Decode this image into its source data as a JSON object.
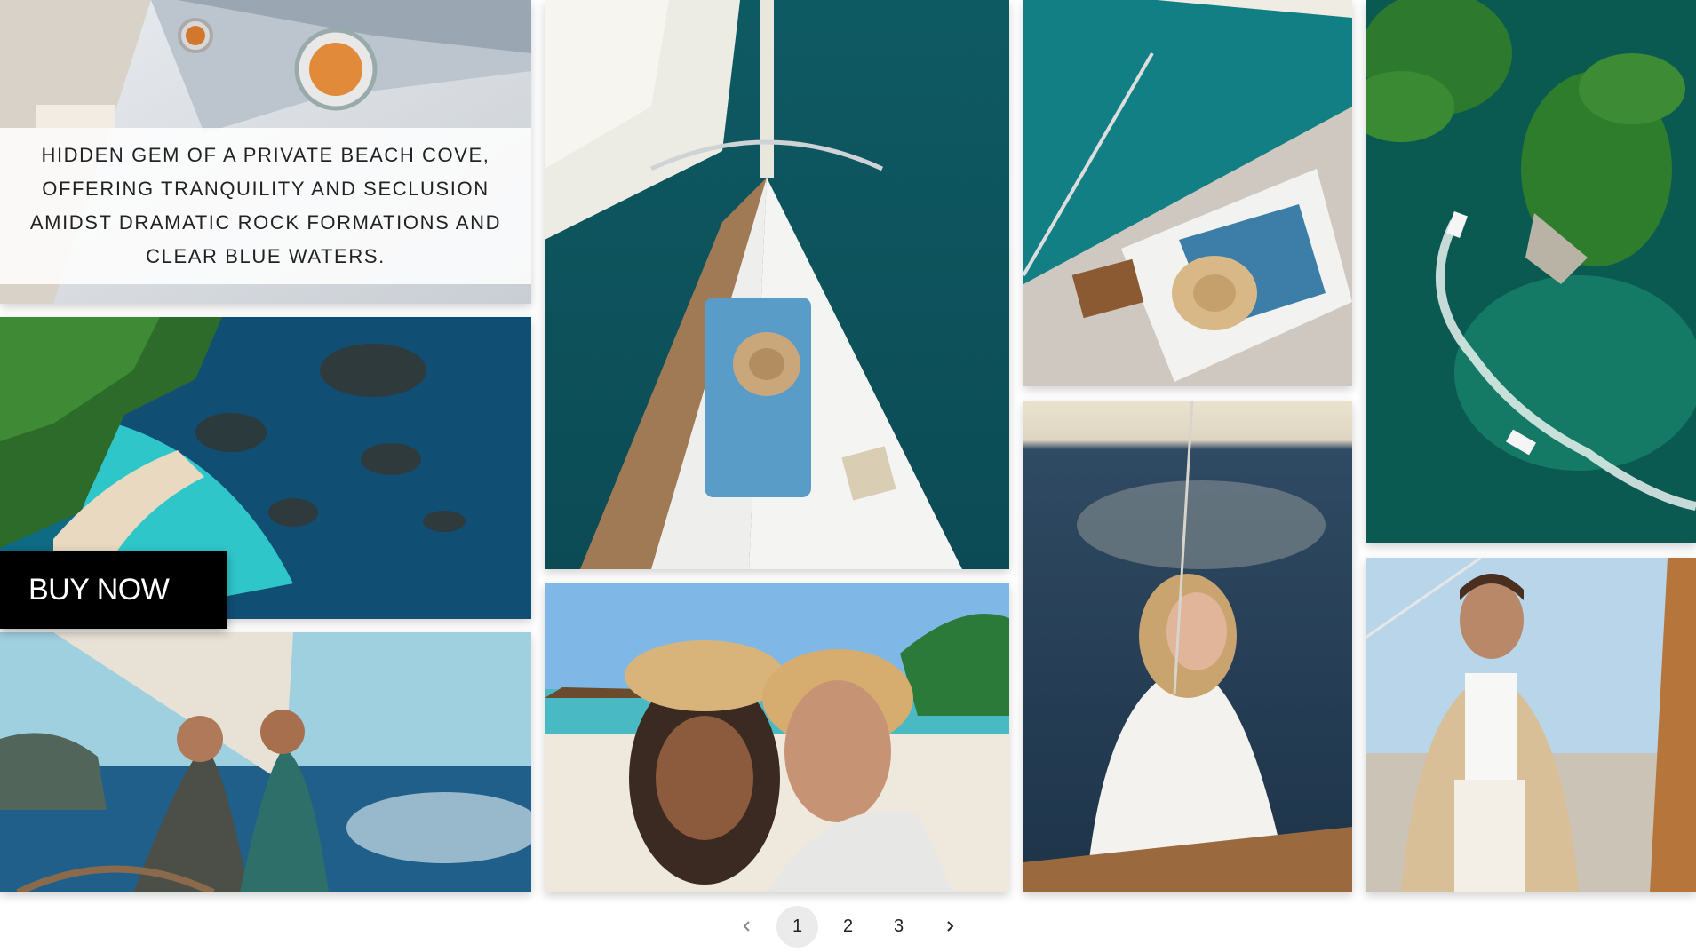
{
  "caption": {
    "text": "Hidden gem of a private beach cove, offering tranquility and seclusion amidst dramatic rock formations and clear blue waters."
  },
  "cta": {
    "buy_label": "BUY NOW"
  },
  "pagination": {
    "pages": [
      "1",
      "2",
      "3"
    ],
    "current": "1",
    "prev_icon": "chevron-left-icon",
    "next_icon": "chevron-right-icon"
  },
  "colors": {
    "sea_dark": "#0d4f5a",
    "sea_teal": "#1aa7b0",
    "button_bg": "#000000",
    "active_page_bg": "#ebebeb"
  }
}
